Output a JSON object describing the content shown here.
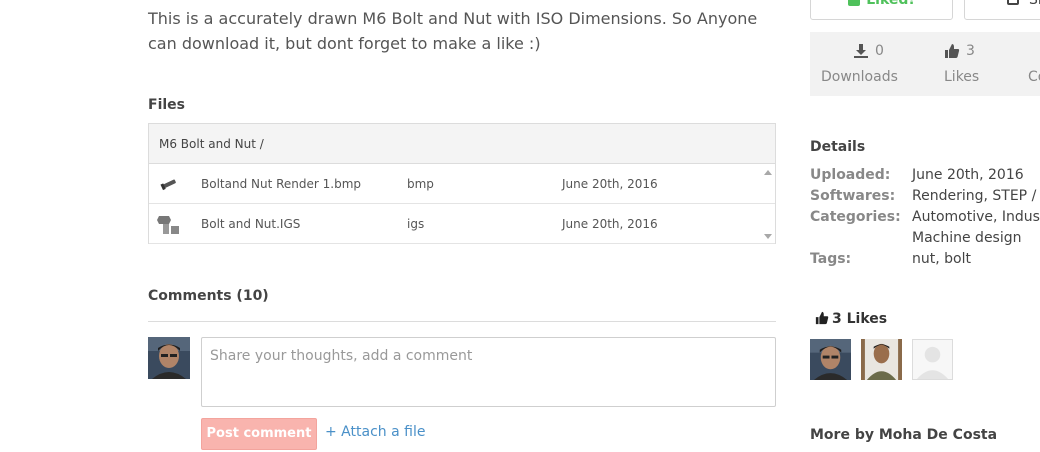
{
  "description": "This is a accurately drawn M6 Bolt and Nut with ISO Dimensions. So Anyone can download it, but dont forget to make a like :)",
  "files": {
    "heading": "Files",
    "folder": "M6 Bolt and Nut /",
    "rows": [
      {
        "name": "Boltand Nut Render 1.bmp",
        "type": "bmp",
        "date": "June 20th, 2016"
      },
      {
        "name": "Bolt and Nut.IGS",
        "type": "igs",
        "date": "June 20th, 2016"
      }
    ]
  },
  "comments": {
    "heading": "Comments (10)",
    "placeholder": "Share your thoughts, add a comment",
    "post_label": "Post comment",
    "attach_label": "+ Attach a file"
  },
  "actions": {
    "liked_label": "Liked!",
    "share_label": "Sh"
  },
  "stats": {
    "downloads_count": "0",
    "downloads_label": "Downloads",
    "likes_count": "3",
    "likes_label": "Likes",
    "comments_label": "Co"
  },
  "details": {
    "heading": "Details",
    "uploaded_key": "Uploaded:",
    "uploaded_val": "June 20th, 2016",
    "softwares_key": "Softwares:",
    "softwares_val": "Rendering, STEP / IG",
    "categories_key": "Categories:",
    "categories_val1": "Automotive, Industr",
    "categories_val2": "Machine design",
    "tags_key": "Tags:",
    "tags_val": "nut, bolt"
  },
  "likes_panel": {
    "title": "3 Likes"
  },
  "more_by": "More by Moha De Costa",
  "colors": {
    "accent_green": "#4fc15b",
    "post_button": "#f9b4ae",
    "link_blue": "#4a90c8"
  }
}
